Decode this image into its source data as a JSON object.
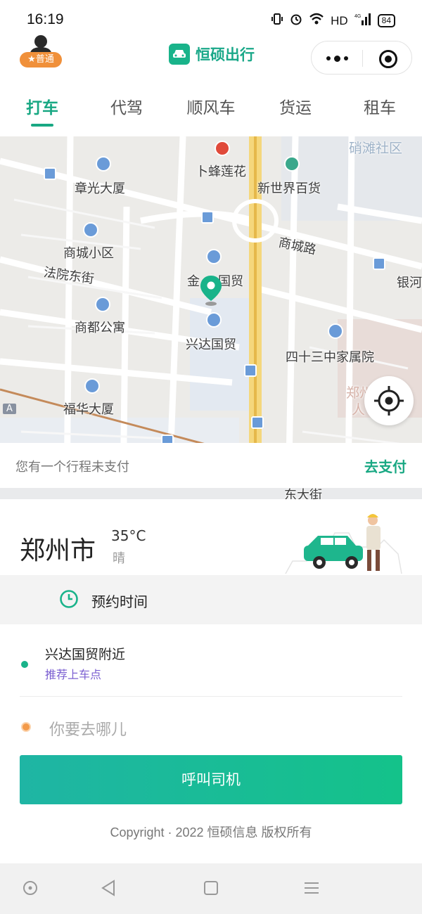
{
  "status_bar": {
    "time": "16:19",
    "network": "HD",
    "signal": "4G",
    "battery": "84"
  },
  "header": {
    "user_badge": "★普通",
    "app_name": "恒硕出行",
    "icons": [
      "user-avatar-icon",
      "car-logo-icon",
      "more-icon",
      "close-miniprogram-icon"
    ]
  },
  "tabs": [
    {
      "label": "打车",
      "active": true
    },
    {
      "label": "代驾",
      "active": false
    },
    {
      "label": "顺风车",
      "active": false
    },
    {
      "label": "货运",
      "active": false
    },
    {
      "label": "租车",
      "active": false
    }
  ],
  "map": {
    "labels": {
      "shaotan": "硝滩社区",
      "bufeng": "卜蜂莲花",
      "zhangguang": "章光大厦",
      "xinshijie": "新世界百货",
      "shangcheng_road": "商城路",
      "shangcheng_xiaoqu": "商城小区",
      "fayuan": "法院东街",
      "jinguo": "金",
      "jinguo2": "国贸",
      "yinhe": "银河",
      "shangdu": "商都公寓",
      "xingda": "兴达国贸",
      "sishisan": "四十三中家属院",
      "zhengzhou_partial": "郑州",
      "ren_partial": "人",
      "fuhua": "福华大厦",
      "dongdajie": "东大街",
      "a_marker": "A"
    }
  },
  "unpaid_bar": {
    "message": "您有一个行程未支付",
    "action": "去支付"
  },
  "weather": {
    "city": "郑州市",
    "temperature": "35°C",
    "condition": "晴"
  },
  "reserve": {
    "label": "预约时间"
  },
  "pickup": {
    "address": "兴达国贸附近",
    "hint": "推荐上车点"
  },
  "destination": {
    "placeholder": "你要去哪儿"
  },
  "call_button": "呼叫司机",
  "copyright": "Copyright · 2022 恒硕信息 版权所有",
  "colors": {
    "accent": "#19a883",
    "pickup_dot": "#19b38a",
    "dest_dot": "#f39a4a",
    "hint": "#7b5fd1"
  }
}
